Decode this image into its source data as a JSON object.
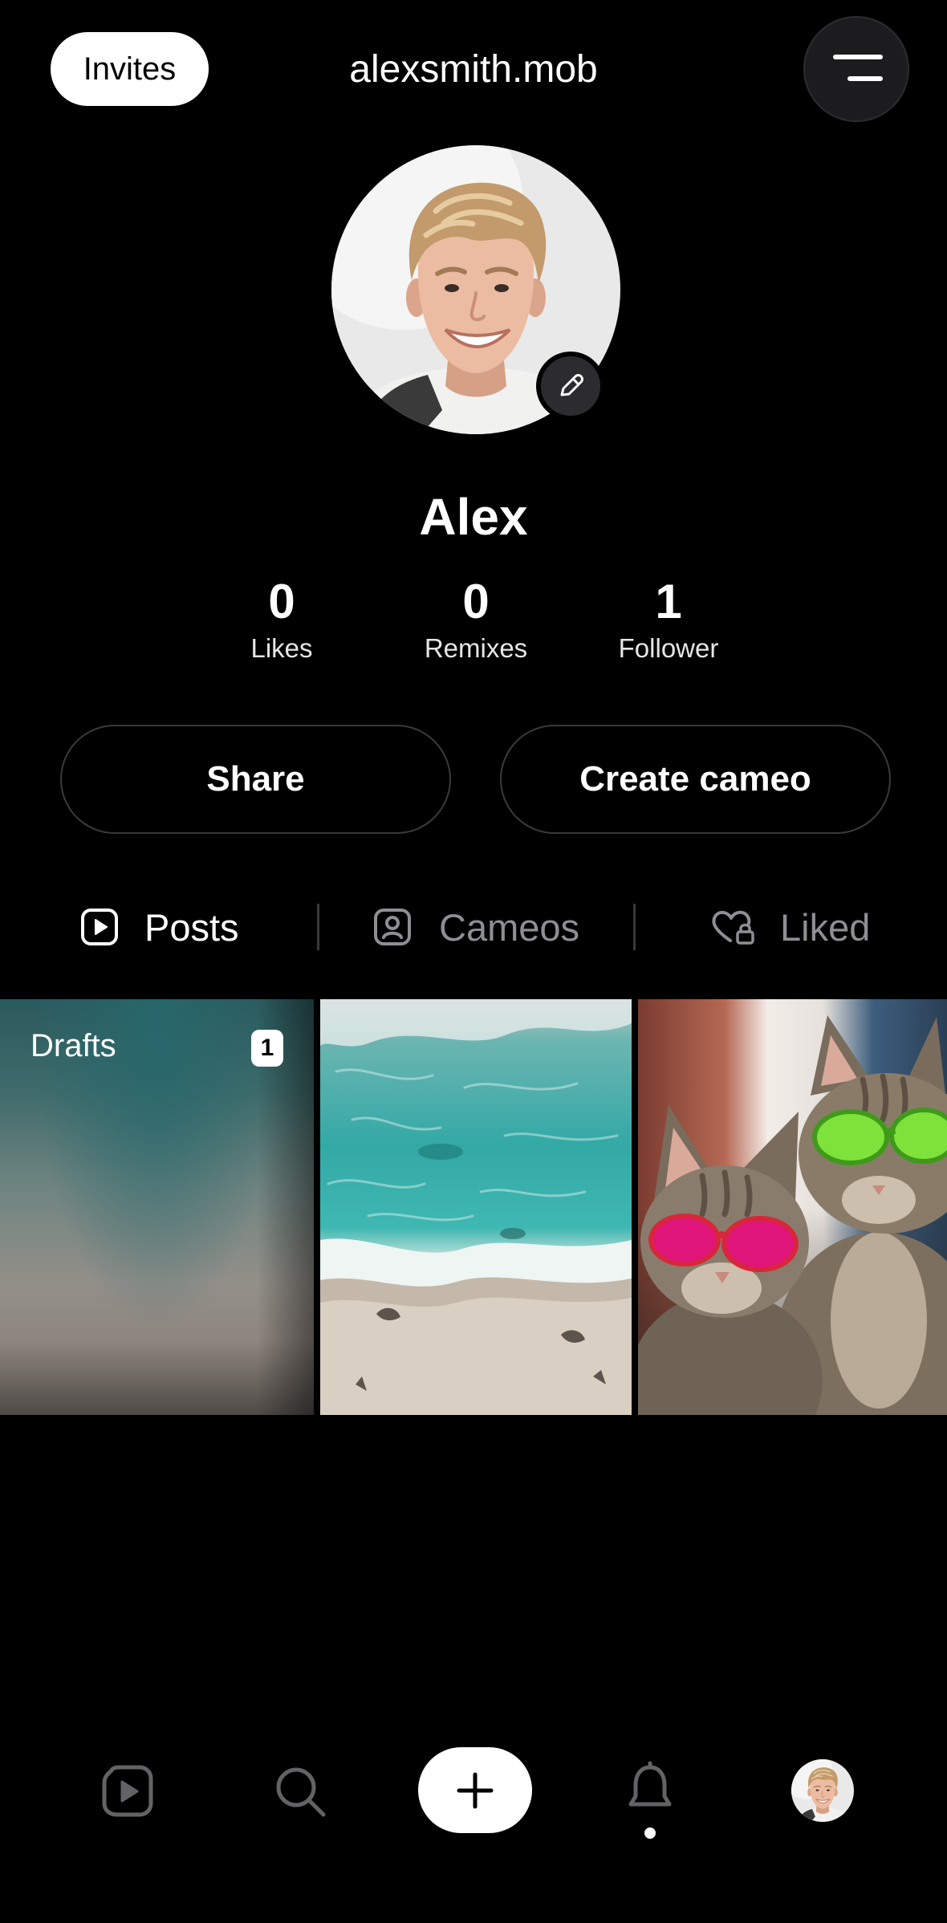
{
  "header": {
    "invites_label": "Invites",
    "username": "alexsmith.mob",
    "menu_icon": "menu-icon"
  },
  "profile": {
    "name": "Alex",
    "avatar_icon": "avatar",
    "edit_icon": "pencil-icon"
  },
  "stats": [
    {
      "value": "0",
      "label": "Likes"
    },
    {
      "value": "0",
      "label": "Remixes"
    },
    {
      "value": "1",
      "label": "Follower"
    }
  ],
  "actions": {
    "share_label": "Share",
    "create_cameo_label": "Create cameo"
  },
  "tabs": [
    {
      "label": "Posts",
      "icon": "play-square-icon",
      "active": true
    },
    {
      "label": "Cameos",
      "icon": "person-square-icon",
      "active": false
    },
    {
      "label": "Liked",
      "icon": "heart-lock-icon",
      "active": false
    }
  ],
  "grid": {
    "drafts_label": "Drafts",
    "drafts_count": "1"
  },
  "bottom_nav": {
    "items": [
      {
        "icon": "feed-icon"
      },
      {
        "icon": "search-icon"
      },
      {
        "icon": "plus-icon",
        "primary": true
      },
      {
        "icon": "bell-icon",
        "has_indicator": true
      },
      {
        "icon": "profile-avatar"
      }
    ]
  },
  "colors": {
    "background": "#000000",
    "text": "#ffffff",
    "muted_text": "#8e8e93",
    "nav_icon": "#636366",
    "button_border": "#3a3a3c",
    "pill_background": "#ffffff"
  }
}
